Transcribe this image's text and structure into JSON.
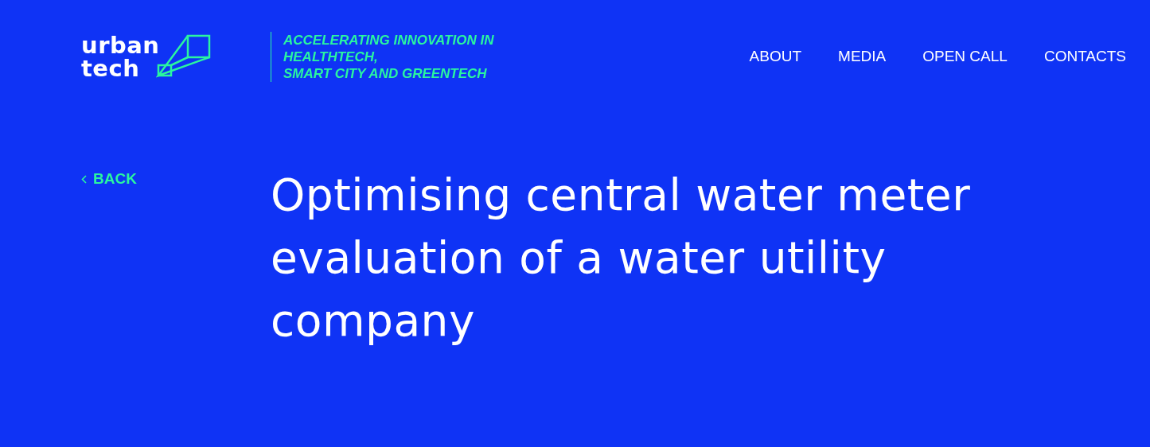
{
  "logo": {
    "lines": [
      "urban",
      "tech"
    ]
  },
  "tagline": {
    "lines": [
      "ACCELERATING INNOVATION IN",
      "HEALTHTECH,",
      "SMART CITY AND GREENTECH"
    ]
  },
  "nav": [
    {
      "label": "ABOUT"
    },
    {
      "label": "MEDIA"
    },
    {
      "label": "OPEN CALL"
    },
    {
      "label": "CONTACTS"
    }
  ],
  "back_link": {
    "label": "BACK"
  },
  "title": "Optimising central water meter evaluation of a water utility company"
}
